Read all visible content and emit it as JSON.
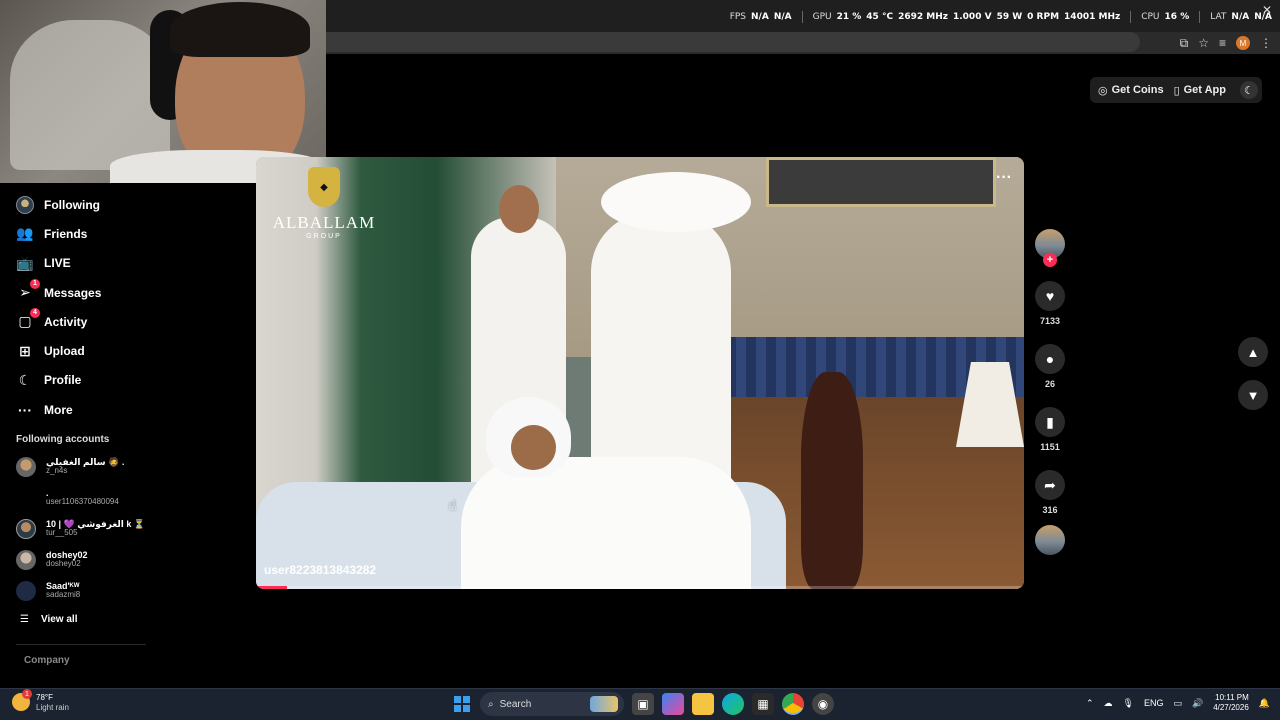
{
  "hud": {
    "fps_label": "FPS",
    "fps_value1": "N/A",
    "fps_value2": "N/A",
    "gpu_label": "GPU",
    "gpu_load": "21 %",
    "gpu_temp": "45 °C",
    "gpu_clock": "2692 MHz",
    "gpu_volt": "1.000 V",
    "gpu_power": "59 W",
    "gpu_fan": "0 RPM",
    "gpu_mem": "14001 MHz",
    "cpu_label": "CPU",
    "cpu_load": "16 %",
    "lat_label": "LAT",
    "lat_value1": "N/A",
    "lat_value2": "N/A"
  },
  "header": {
    "get_coins": "Get Coins",
    "get_app": "Get App",
    "profile_initial": "M"
  },
  "sidebar": {
    "items": [
      {
        "label": "Following",
        "icon": "following-avatar-icon"
      },
      {
        "label": "Friends",
        "icon": "friends-icon"
      },
      {
        "label": "LIVE",
        "icon": "live-tv-icon"
      },
      {
        "label": "Messages",
        "icon": "messages-icon",
        "badge": "1"
      },
      {
        "label": "Activity",
        "icon": "activity-icon",
        "badge": "4"
      },
      {
        "label": "Upload",
        "icon": "upload-plus-icon"
      },
      {
        "label": "Profile",
        "icon": "profile-icon"
      },
      {
        "label": "More",
        "icon": "more-dots-icon"
      }
    ],
    "following_title": "Following accounts",
    "accounts": [
      {
        "name": "سالم الغفيلي 🧔 .",
        "id": "z_n4s"
      },
      {
        "name": ".",
        "id": "user1106370480094"
      },
      {
        "name": "10 | 💜 الغرفوشي k ⏳",
        "id": "tur__505"
      },
      {
        "name": "doshey02",
        "id": "doshey02"
      },
      {
        "name": "Saad'ᴷᵂ",
        "id": "sadazmi8"
      }
    ],
    "view_all": "View all",
    "company": "Company"
  },
  "video": {
    "logo_name": "ALBALLAM",
    "logo_sub": "GROUP",
    "username": "user8223813843282",
    "progress": 0.04
  },
  "actions": {
    "likes": "7133",
    "comments": "26",
    "saves": "1151",
    "shares": "316"
  },
  "taskbar": {
    "temperature": "78°F",
    "condition": "Light rain",
    "weather_badge": "1",
    "search_placeholder": "Search",
    "language": "ENG",
    "time": "10:11 PM",
    "date": "4/27/2026"
  },
  "colors": {
    "accent": "#fe2c55",
    "background": "#000000",
    "taskbar": "#1b2230"
  }
}
